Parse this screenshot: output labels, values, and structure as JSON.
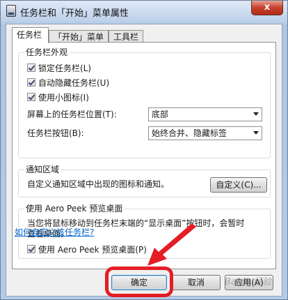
{
  "window": {
    "title": "任务栏和「开始」菜单属性",
    "close_label": "x"
  },
  "tabs": [
    {
      "label": "任务栏",
      "active": true
    },
    {
      "label": "「开始」菜单",
      "active": false
    },
    {
      "label": "工具栏",
      "active": false
    }
  ],
  "appearance": {
    "title": "任务栏外观",
    "checkboxes": [
      {
        "label": "锁定任务栏(L)",
        "checked": true
      },
      {
        "label": "自动隐藏任务栏(U)",
        "checked": true
      },
      {
        "label": "使用小图标(I)",
        "checked": true
      }
    ],
    "position_label": "屏幕上的任务栏位置(T):",
    "position_value": "底部",
    "buttons_label": "任务栏按钮(B):",
    "buttons_value": "始终合并、隐藏标签"
  },
  "notification": {
    "title": "通知区域",
    "description": "自定义通知区域中出现的图标和通知。",
    "customize_button": "自定义(C)..."
  },
  "peek": {
    "title": "使用 Aero Peek 预览桌面",
    "description_line1": "当您将鼠标移动到任务栏末端的“显示桌面”按钮时，会暂时",
    "description_line2": "查看桌面。",
    "checkbox_label": "使用 Aero Peek 预览桌面(P)",
    "checked": true
  },
  "help_link": "如何自定义该任务栏?",
  "footer": {
    "ok": "确定",
    "cancel": "取消",
    "apply": "应用(A)"
  },
  "watermark": "Baidu 经验",
  "colors": {
    "annotation_red": "#e31e24",
    "link_blue": "#0066cc"
  }
}
